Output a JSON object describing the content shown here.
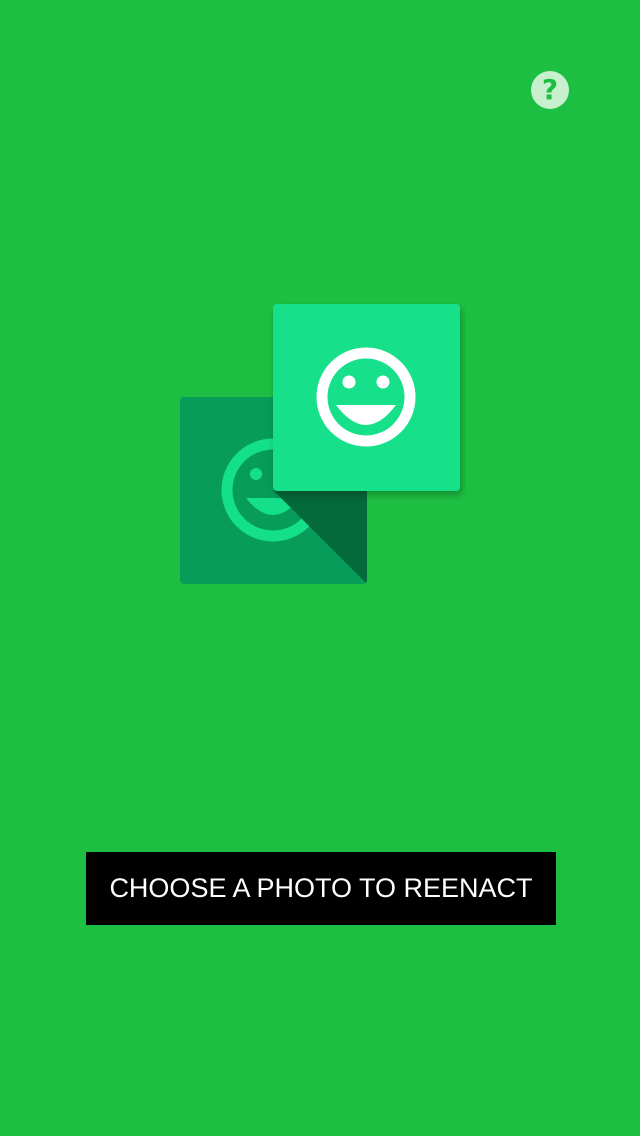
{
  "header": {
    "help_icon": "question-mark-icon"
  },
  "logo": {
    "icon": "smiley-chat-bubbles-icon",
    "colors": {
      "back_tile": "#079c58",
      "front_tile": "#14e08a",
      "face": "#ffffff"
    }
  },
  "actions": {
    "choose_photo_label": "CHOOSE A PHOTO TO REENACT"
  },
  "colors": {
    "background": "#1dbf42",
    "button_background": "#000000",
    "button_text": "#ffffff",
    "help_circle": "#c8f0cf"
  }
}
